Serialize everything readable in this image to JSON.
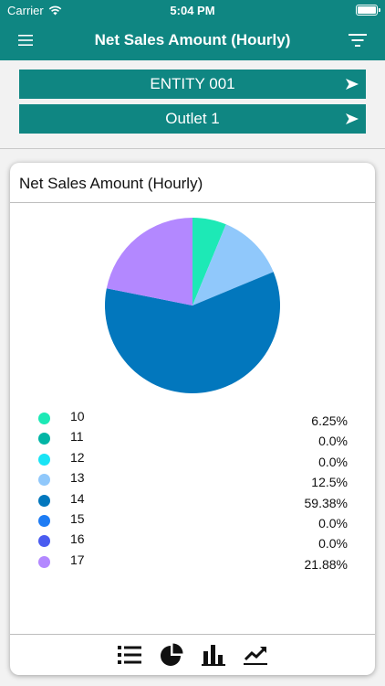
{
  "status_bar": {
    "carrier": "Carrier",
    "time": "5:04 PM",
    "battery_level": 1.0
  },
  "nav": {
    "title": "Net Sales Amount (Hourly)",
    "menu_icon": "hamburger-icon",
    "filter_icon": "filter-icon"
  },
  "selectors": {
    "entity": {
      "label": "ENTITY 001",
      "arrow_icon": "arrow-right-icon"
    },
    "outlet": {
      "label": "Outlet 1",
      "arrow_icon": "arrow-right-icon"
    }
  },
  "card": {
    "title": "Net Sales Amount (Hourly)"
  },
  "toolbar": [
    "list-icon",
    "pie-chart-icon",
    "bar-chart-icon",
    "line-chart-icon"
  ],
  "colors": {
    "brand": "#0f8682"
  },
  "chart_data": {
    "type": "pie",
    "categories": [
      "10",
      "11",
      "12",
      "13",
      "14",
      "15",
      "16",
      "17"
    ],
    "values": [
      6.25,
      0.0,
      0.0,
      12.5,
      59.38,
      0.0,
      0.0,
      21.88
    ],
    "value_labels": [
      "6.25%",
      "0.0%",
      "0.0%",
      "12.5%",
      "59.38%",
      "0.0%",
      "0.0%",
      "21.88%"
    ],
    "colors": [
      "#1de9b6",
      "#00b5a5",
      "#19e4f5",
      "#90c8fb",
      "#0277bd",
      "#1e7cf4",
      "#4a5cf0",
      "#b388ff"
    ]
  }
}
